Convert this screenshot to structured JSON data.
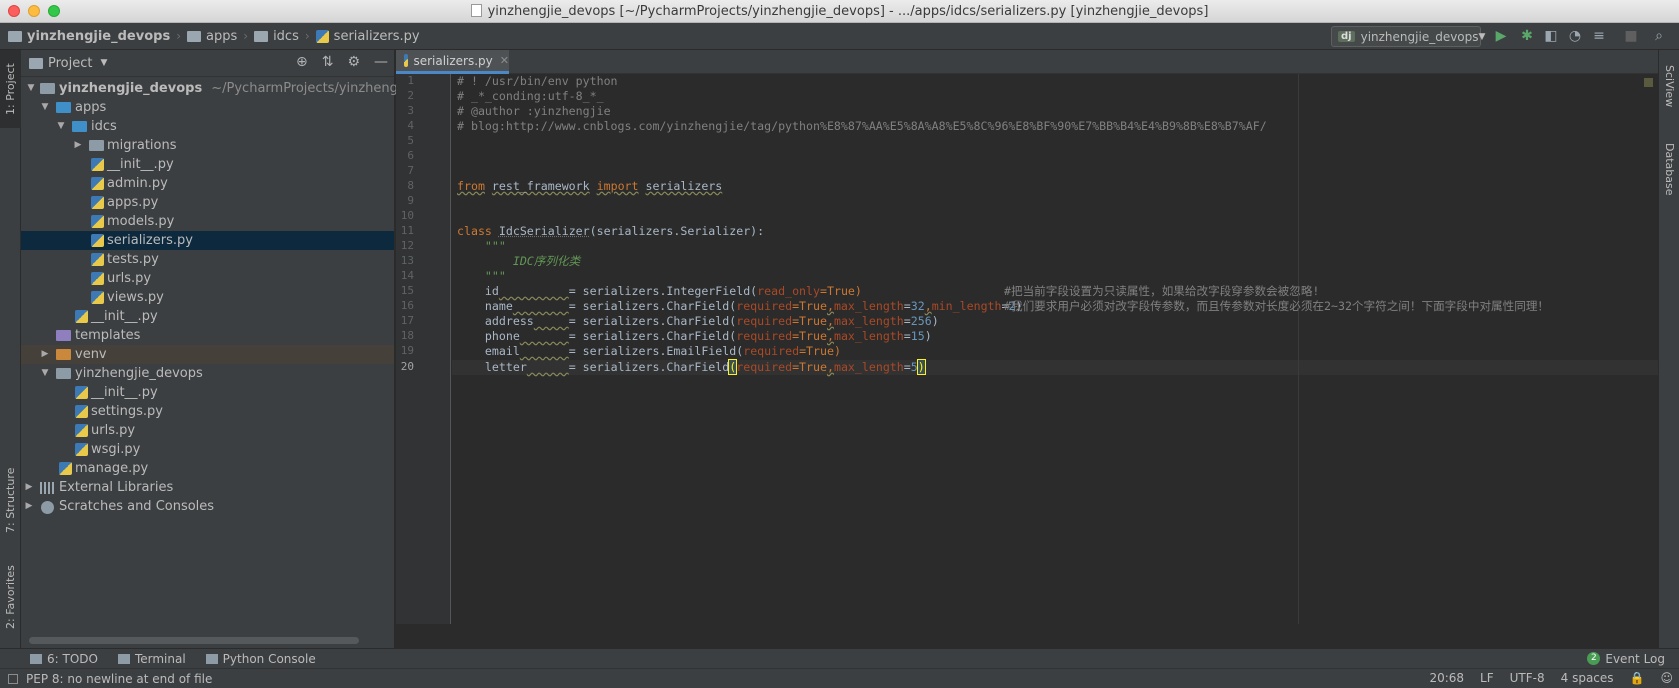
{
  "window": {
    "title": "yinzhengjie_devops [~/PycharmProjects/yinzhengjie_devops] - .../apps/idcs/serializers.py [yinzhengjie_devops]"
  },
  "navbar": {
    "crumbs": [
      "yinzhengjie_devops",
      "apps",
      "idcs",
      "serializers.py"
    ],
    "run_config": "yinzhengjie_devops",
    "run_icon": "play-icon",
    "debug_icon": "bug-icon"
  },
  "left_strip": {
    "project_tab": "1: Project",
    "structure_tab": "7: Structure",
    "favorites_tab": "2: Favorites"
  },
  "right_strip": {
    "sciview_tab": "SciView",
    "database_tab": "Database"
  },
  "project_panel": {
    "title": "Project",
    "root_name": "yinzhengjie_devops",
    "root_path": "~/PycharmProjects/yinzhengjie_d",
    "items": [
      {
        "label": "apps"
      },
      {
        "label": "idcs"
      },
      {
        "label": "migrations"
      },
      {
        "label": "__init__.py"
      },
      {
        "label": "admin.py"
      },
      {
        "label": "apps.py"
      },
      {
        "label": "models.py"
      },
      {
        "label": "serializers.py"
      },
      {
        "label": "tests.py"
      },
      {
        "label": "urls.py"
      },
      {
        "label": "views.py"
      },
      {
        "label": "__init__.py"
      },
      {
        "label": "templates"
      },
      {
        "label": "venv"
      },
      {
        "label": "yinzhengjie_devops"
      },
      {
        "label": "__init__.py"
      },
      {
        "label": "settings.py"
      },
      {
        "label": "urls.py"
      },
      {
        "label": "wsgi.py"
      },
      {
        "label": "manage.py"
      },
      {
        "label": "External Libraries"
      },
      {
        "label": "Scratches and Consoles"
      }
    ]
  },
  "editor": {
    "tab_label": "serializers.py",
    "line_numbers": [
      "1",
      "2",
      "3",
      "4",
      "5",
      "6",
      "7",
      "8",
      "9",
      "10",
      "11",
      "12",
      "13",
      "14",
      "15",
      "16",
      "17",
      "18",
      "19",
      "20"
    ],
    "code": {
      "l1": "# ! /usr/bin/env python",
      "l2": "# _*_conding:utf-8_*_",
      "l3": "# @author :yinzhengjie",
      "l4": "# blog:http://www.cnblogs.com/yinzhengjie/tag/python%E8%87%AA%E5%8A%A8%E5%8C%96%E8%BF%90%E7%BB%B4%E4%B9%8B%E8%B7%AF/",
      "l8_from": "from",
      "l8_mod": "rest_framework",
      "l8_import": "import",
      "l8_name": "serializers",
      "l11_class": "class",
      "l11_name": "IdcSerializer",
      "l11_rest": "(serializers.Serializer):",
      "l12": "\"\"\"",
      "l13": "IDC序列化类",
      "l14": "\"\"\"",
      "l15_field": "id",
      "l15_rhs": "= serializers.IntegerField(",
      "l15_k1": "read_only",
      "l15_v1": "=True)",
      "l15_comment": "#把当前字段设置为只读属性，如果给改字段穿参数会被忽略!",
      "l16_field": "name",
      "l16_rhs": "= serializers.CharField(",
      "l16_k1": "required",
      "l16_v1": "=True",
      "l16_k2": "max_length",
      "l16_n2": "32",
      "l16_k3": "min_length",
      "l16_n3": "2",
      "l16_comment": "#我们要求用户必须对改字段传参数，而且传参数对长度必须在2~32个字符之间！下面字段中对属性同理！",
      "l17_field": "address",
      "l17_rhs": "= serializers.CharField(",
      "l17_k1": "required",
      "l17_v1": "=True",
      "l17_k2": "max_length",
      "l17_n2": "256",
      "l18_field": "phone",
      "l18_rhs": "= serializers.CharField(",
      "l18_k1": "required",
      "l18_v1": "=True",
      "l18_k2": "max_length",
      "l18_n2": "15",
      "l19_field": "email",
      "l19_rhs": "= serializers.EmailField(",
      "l19_k1": "required",
      "l19_v1": "=True)",
      "l20_field": "letter",
      "l20_rhs": "= serializers.CharField",
      "l20_k1": "required",
      "l20_v1": "=True",
      "l20_k2": "max_length",
      "l20_n2": "5"
    }
  },
  "bottom_tools": {
    "todo": "6: TODO",
    "terminal": "Terminal",
    "python_console": "Python Console",
    "event_log": "Event Log",
    "event_count": "2"
  },
  "status": {
    "message": "PEP 8: no newline at end of file",
    "position": "20:68",
    "line_sep": "LF",
    "encoding": "UTF-8",
    "indent": "4 spaces"
  },
  "colors": {
    "keyword": "#cc7832",
    "comment": "#808080",
    "docstring": "#629755",
    "kwarg": "#aa4926",
    "number": "#6897bb",
    "selection": "#0d293e"
  }
}
